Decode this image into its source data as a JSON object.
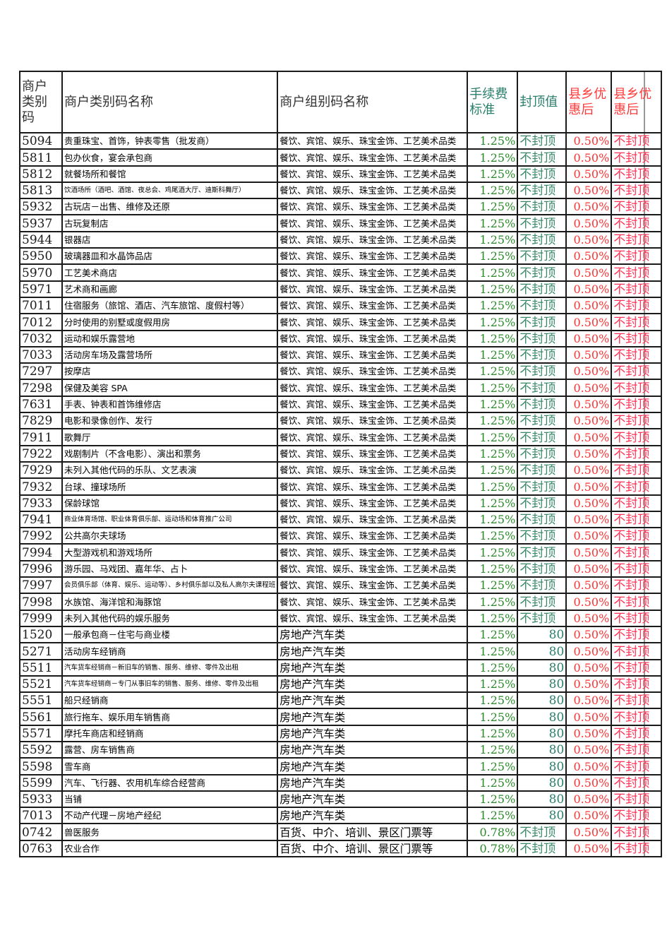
{
  "header": {
    "code": "商户类别码",
    "code_lines": [
      "商户",
      "类别",
      "码"
    ],
    "name": "商户类别码名称",
    "group": "商户组别码名称",
    "fee": "手续费标准",
    "fee_lines": [
      "手续费",
      "标准"
    ],
    "cap": "封顶值",
    "county_fee": "县乡优惠后",
    "county_fee_lines": [
      "县乡优",
      "惠后"
    ],
    "county_cap": "县乡优惠后",
    "county_cap_lines": [
      "县乡优",
      "惠后"
    ]
  },
  "colors": {
    "fee": "#2a8a2a",
    "cap": "#2a7f6a",
    "county": "#ff3333"
  },
  "rows": [
    {
      "code": "5094",
      "name": "贵重珠宝、首饰，钟表零售（批发商）",
      "group": "餐饮、宾馆、娱乐、珠宝金饰、工艺美术品类",
      "fee": "1.25%",
      "cap": "不封顶",
      "county_fee": "0.50%",
      "county_cap": "不封顶"
    },
    {
      "code": "5811",
      "name": "包办伙食，宴会承包商",
      "group": "餐饮、宾馆、娱乐、珠宝金饰、工艺美术品类",
      "fee": "1.25%",
      "cap": "不封顶",
      "county_fee": "0.50%",
      "county_cap": "不封顶"
    },
    {
      "code": "5812",
      "name": "就餐场所和餐馆",
      "group": "餐饮、宾馆、娱乐、珠宝金饰、工艺美术品类",
      "fee": "1.25%",
      "cap": "不封顶",
      "county_fee": "0.50%",
      "county_cap": "不封顶"
    },
    {
      "code": "5813",
      "name": "饮酒场所（酒吧、酒馆、夜总会、鸡尾酒大厅、迪斯科舞厅）",
      "small": true,
      "group": "餐饮、宾馆、娱乐、珠宝金饰、工艺美术品类",
      "fee": "1.25%",
      "cap": "不封顶",
      "county_fee": "0.50%",
      "county_cap": "不封顶"
    },
    {
      "code": "5932",
      "name": "古玩店－出售、维修及还原",
      "group": "餐饮、宾馆、娱乐、珠宝金饰、工艺美术品类",
      "fee": "1.25%",
      "cap": "不封顶",
      "county_fee": "0.50%",
      "county_cap": "不封顶"
    },
    {
      "code": "5937",
      "name": "古玩复制店",
      "group": "餐饮、宾馆、娱乐、珠宝金饰、工艺美术品类",
      "fee": "1.25%",
      "cap": "不封顶",
      "county_fee": "0.50%",
      "county_cap": "不封顶"
    },
    {
      "code": "5944",
      "name": "银器店",
      "group": "餐饮、宾馆、娱乐、珠宝金饰、工艺美术品类",
      "fee": "1.25%",
      "cap": "不封顶",
      "county_fee": "0.50%",
      "county_cap": "不封顶"
    },
    {
      "code": "5950",
      "name": "玻璃器皿和水晶饰品店",
      "group": "餐饮、宾馆、娱乐、珠宝金饰、工艺美术品类",
      "fee": "1.25%",
      "cap": "不封顶",
      "county_fee": "0.50%",
      "county_cap": "不封顶"
    },
    {
      "code": "5970",
      "name": "工艺美术商店",
      "group": "餐饮、宾馆、娱乐、珠宝金饰、工艺美术品类",
      "fee": "1.25%",
      "cap": "不封顶",
      "county_fee": "0.50%",
      "county_cap": "不封顶"
    },
    {
      "code": "5971",
      "name": "艺术商和画廊",
      "group": "餐饮、宾馆、娱乐、珠宝金饰、工艺美术品类",
      "fee": "1.25%",
      "cap": "不封顶",
      "county_fee": "0.50%",
      "county_cap": "不封顶"
    },
    {
      "code": "7011",
      "name": "住宿服务（旅馆、酒店、汽车旅馆、度假村等）",
      "group": "餐饮、宾馆、娱乐、珠宝金饰、工艺美术品类",
      "fee": "1.25%",
      "cap": "不封顶",
      "county_fee": "0.50%",
      "county_cap": "不封顶"
    },
    {
      "code": "7012",
      "name": "分时使用的别墅或度假用房",
      "group": "餐饮、宾馆、娱乐、珠宝金饰、工艺美术品类",
      "fee": "1.25%",
      "cap": "不封顶",
      "county_fee": "0.50%",
      "county_cap": "不封顶"
    },
    {
      "code": "7032",
      "name": "运动和娱乐露营地",
      "group": "餐饮、宾馆、娱乐、珠宝金饰、工艺美术品类",
      "fee": "1.25%",
      "cap": "不封顶",
      "county_fee": "0.50%",
      "county_cap": "不封顶"
    },
    {
      "code": "7033",
      "name": "活动房车场及露营场所",
      "group": "餐饮、宾馆、娱乐、珠宝金饰、工艺美术品类",
      "fee": "1.25%",
      "cap": "不封顶",
      "county_fee": "0.50%",
      "county_cap": "不封顶"
    },
    {
      "code": "7297",
      "name": "按摩店",
      "group": "餐饮、宾馆、娱乐、珠宝金饰、工艺美术品类",
      "fee": "1.25%",
      "cap": "不封顶",
      "county_fee": "0.50%",
      "county_cap": "不封顶"
    },
    {
      "code": "7298",
      "name": "保健及美容 SPA",
      "group": "餐饮、宾馆、娱乐、珠宝金饰、工艺美术品类",
      "fee": "1.25%",
      "cap": "不封顶",
      "county_fee": "0.50%",
      "county_cap": "不封顶"
    },
    {
      "code": "7631",
      "name": "手表、钟表和首饰维修店",
      "group": "餐饮、宾馆、娱乐、珠宝金饰、工艺美术品类",
      "fee": "1.25%",
      "cap": "不封顶",
      "county_fee": "0.50%",
      "county_cap": "不封顶"
    },
    {
      "code": "7829",
      "name": "电影和录像创作、发行",
      "group": "餐饮、宾馆、娱乐、珠宝金饰、工艺美术品类",
      "fee": "1.25%",
      "cap": "不封顶",
      "county_fee": "0.50%",
      "county_cap": "不封顶"
    },
    {
      "code": "7911",
      "name": "歌舞厅",
      "group": "餐饮、宾馆、娱乐、珠宝金饰、工艺美术品类",
      "fee": "1.25%",
      "cap": "不封顶",
      "county_fee": "0.50%",
      "county_cap": "不封顶"
    },
    {
      "code": "7922",
      "name": "戏剧制片（不含电影）、演出和票务",
      "group": "餐饮、宾馆、娱乐、珠宝金饰、工艺美术品类",
      "fee": "1.25%",
      "cap": "不封顶",
      "county_fee": "0.50%",
      "county_cap": "不封顶"
    },
    {
      "code": "7929",
      "name": "未列入其他代码的乐队、文艺表演",
      "group": "餐饮、宾馆、娱乐、珠宝金饰、工艺美术品类",
      "fee": "1.25%",
      "cap": "不封顶",
      "county_fee": "0.50%",
      "county_cap": "不封顶"
    },
    {
      "code": "7932",
      "name": "台球、撞球场所",
      "group": "餐饮、宾馆、娱乐、珠宝金饰、工艺美术品类",
      "fee": "1.25%",
      "cap": "不封顶",
      "county_fee": "0.50%",
      "county_cap": "不封顶"
    },
    {
      "code": "7933",
      "name": "保龄球馆",
      "group": "餐饮、宾馆、娱乐、珠宝金饰、工艺美术品类",
      "fee": "1.25%",
      "cap": "不封顶",
      "county_fee": "0.50%",
      "county_cap": "不封顶"
    },
    {
      "code": "7941",
      "name": "商业体育场馆、职业体育俱乐部、运动场和体育推广公司",
      "small": true,
      "group": "餐饮、宾馆、娱乐、珠宝金饰、工艺美术品类",
      "fee": "1.25%",
      "cap": "不封顶",
      "county_fee": "0.50%",
      "county_cap": "不封顶"
    },
    {
      "code": "7992",
      "name": "公共高尔夫球场",
      "group": "餐饮、宾馆、娱乐、珠宝金饰、工艺美术品类",
      "fee": "1.25%",
      "cap": "不封顶",
      "county_fee": "0.50%",
      "county_cap": "不封顶"
    },
    {
      "code": "7994",
      "name": "大型游戏机和游戏场所",
      "group": "餐饮、宾馆、娱乐、珠宝金饰、工艺美术品类",
      "fee": "1.25%",
      "cap": "不封顶",
      "county_fee": "0.50%",
      "county_cap": "不封顶"
    },
    {
      "code": "7996",
      "name": "游乐园、马戏团、嘉年华、占卜",
      "group": "餐饮、宾馆、娱乐、珠宝金饰、工艺美术品类",
      "fee": "1.25%",
      "cap": "不封顶",
      "county_fee": "0.50%",
      "county_cap": "不封顶"
    },
    {
      "code": "7997",
      "name": "会员俱乐部（体育、娱乐、运动等）、乡村俱乐部以及私人高尔夫课程班",
      "small": true,
      "group": "餐饮、宾馆、娱乐、珠宝金饰、工艺美术品类",
      "fee": "1.25%",
      "cap": "不封顶",
      "county_fee": "0.50%",
      "county_cap": "不封顶"
    },
    {
      "code": "7998",
      "name": "水族馆、海洋馆和海豚馆",
      "group": "餐饮、宾馆、娱乐、珠宝金饰、工艺美术品类",
      "fee": "1.25%",
      "cap": "不封顶",
      "county_fee": "0.50%",
      "county_cap": "不封顶"
    },
    {
      "code": "7999",
      "name": "未列入其他代码的娱乐服务",
      "group": "餐饮、宾馆、娱乐、珠宝金饰、工艺美术品类",
      "fee": "1.25%",
      "cap": "不封顶",
      "county_fee": "0.50%",
      "county_cap": "不封顶"
    },
    {
      "code": "1520",
      "name": "一般承包商－住宅与商业楼",
      "group": "房地产汽车类",
      "bigGroup": true,
      "fee": "1.25%",
      "cap": "80",
      "capNum": true,
      "county_fee": "0.50%",
      "county_cap": "不封顶"
    },
    {
      "code": "5271",
      "name": "活动房车经销商",
      "group": "房地产汽车类",
      "bigGroup": true,
      "fee": "1.25%",
      "cap": "80",
      "capNum": true,
      "county_fee": "0.50%",
      "county_cap": "不封顶"
    },
    {
      "code": "5511",
      "name": "汽车货车经销商－新旧车的销售、服务、维修、零件及出租",
      "small": true,
      "group": "房地产汽车类",
      "bigGroup": true,
      "fee": "1.25%",
      "cap": "80",
      "capNum": true,
      "county_fee": "0.50%",
      "county_cap": "不封顶"
    },
    {
      "code": "5521",
      "name": "汽车货车经销商－专门从事旧车的销售、服务、维修、零件及出租",
      "small": true,
      "group": "房地产汽车类",
      "bigGroup": true,
      "fee": "1.25%",
      "cap": "80",
      "capNum": true,
      "county_fee": "0.50%",
      "county_cap": "不封顶"
    },
    {
      "code": "5551",
      "name": "船只经销商",
      "group": "房地产汽车类",
      "bigGroup": true,
      "fee": "1.25%",
      "cap": "80",
      "capNum": true,
      "county_fee": "0.50%",
      "county_cap": "不封顶"
    },
    {
      "code": "5561",
      "name": "旅行拖车、娱乐用车销售商",
      "group": "房地产汽车类",
      "bigGroup": true,
      "fee": "1.25%",
      "cap": "80",
      "capNum": true,
      "county_fee": "0.50%",
      "county_cap": "不封顶"
    },
    {
      "code": "5571",
      "name": "摩托车商店和经销商",
      "group": "房地产汽车类",
      "bigGroup": true,
      "fee": "1.25%",
      "cap": "80",
      "capNum": true,
      "county_fee": "0.50%",
      "county_cap": "不封顶"
    },
    {
      "code": "5592",
      "name": "露营、房车销售商",
      "group": "房地产汽车类",
      "bigGroup": true,
      "fee": "1.25%",
      "cap": "80",
      "capNum": true,
      "county_fee": "0.50%",
      "county_cap": "不封顶"
    },
    {
      "code": "5598",
      "name": "雪车商",
      "group": "房地产汽车类",
      "bigGroup": true,
      "fee": "1.25%",
      "cap": "80",
      "capNum": true,
      "county_fee": "0.50%",
      "county_cap": "不封顶"
    },
    {
      "code": "5599",
      "name": "汽车、飞行器、农用机车综合经营商",
      "group": "房地产汽车类",
      "bigGroup": true,
      "fee": "1.25%",
      "cap": "80",
      "capNum": true,
      "county_fee": "0.50%",
      "county_cap": "不封顶"
    },
    {
      "code": "5933",
      "name": "当铺",
      "group": "房地产汽车类",
      "bigGroup": true,
      "fee": "1.25%",
      "cap": "80",
      "capNum": true,
      "county_fee": "0.50%",
      "county_cap": "不封顶"
    },
    {
      "code": "7013",
      "name": "不动产代理－房地产经纪",
      "group": "房地产汽车类",
      "bigGroup": true,
      "fee": "1.25%",
      "cap": "80",
      "capNum": true,
      "county_fee": "0.50%",
      "county_cap": "不封顶"
    },
    {
      "code": "0742",
      "name": "兽医服务",
      "group": "百货、中介、培训、景区门票等",
      "bigGroup": true,
      "fee": "0.78%",
      "cap": "不封顶",
      "county_fee": "0.50%",
      "county_cap": "不封顶"
    },
    {
      "code": "0763",
      "name": "农业合作",
      "group": "百货、中介、培训、景区门票等",
      "bigGroup": true,
      "fee": "0.78%",
      "cap": "不封顶",
      "county_fee": "0.50%",
      "county_cap": "不封顶"
    }
  ]
}
